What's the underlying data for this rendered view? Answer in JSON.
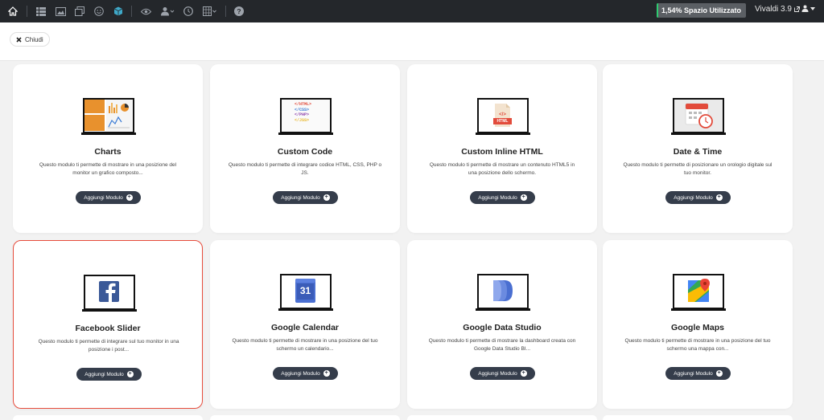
{
  "topbar": {
    "icons": [
      "home-icon",
      "list-icon",
      "image-icon",
      "layers-icon",
      "smiley-icon",
      "cube-icon",
      "eye-icon",
      "user-group-icon",
      "clock-icon",
      "grid-icon",
      "help-icon"
    ],
    "storage_label": "1,54% Spazio Utilizzato",
    "storage_percent": 1.54,
    "version_label": "Vivaldi 3.9",
    "accent_color": "#2ecc71"
  },
  "header": {
    "close_label": "Chiudi"
  },
  "cards": [
    {
      "title": "Charts",
      "desc": "Questo modulo ti permette di mostrare in una posizione del monitor un grafico composto...",
      "button": "Aggiungi Modulo",
      "icon": "charts-icon",
      "selected": false
    },
    {
      "title": "Custom Code",
      "desc": "Questo modulo ti permette di integrare codice HTML, CSS, PHP o JS.",
      "button": "Aggiungi Modulo",
      "icon": "code-icon",
      "selected": false,
      "code_lines": [
        "</HTML>",
        "</CSS>",
        "</PHP>",
        "</JSS>"
      ]
    },
    {
      "title": "Custom Inline HTML",
      "desc": "Questo modulo ti permette di mostrare un contenuto HTML5 in una posizione dello schermo.",
      "button": "Aggiungi Modulo",
      "icon": "html-file-icon",
      "selected": false,
      "badge": "HTML"
    },
    {
      "title": "Date & Time",
      "desc": "Questo modulo ti permette di posizionare un orologio digitale sul tuo monitor.",
      "button": "Aggiungi Modulo",
      "icon": "calendar-clock-icon",
      "selected": false
    },
    {
      "title": "Facebook Slider",
      "desc": "Questo modulo ti permette di integrare sul tuo monitor in una posizione i post...",
      "button": "Aggiungi Modulo",
      "icon": "facebook-icon",
      "selected": true
    },
    {
      "title": "Google Calendar",
      "desc": "Questo modulo ti permette di mostrare in una posizione del tuo schermo un calendario...",
      "button": "Aggiungi Modulo",
      "icon": "google-calendar-icon",
      "selected": false,
      "badge": "31"
    },
    {
      "title": "Google Data Studio",
      "desc": "Questo modulo ti permette di mostrare la dashboard creata con Google Data Studio BI...",
      "button": "Aggiungi Modulo",
      "icon": "data-studio-icon",
      "selected": false
    },
    {
      "title": "Google Maps",
      "desc": "Questo modulo ti permette di mostrare in una posizione del tuo schermo una mappa con...",
      "button": "Aggiungi Modulo",
      "icon": "google-maps-icon",
      "selected": false
    }
  ]
}
